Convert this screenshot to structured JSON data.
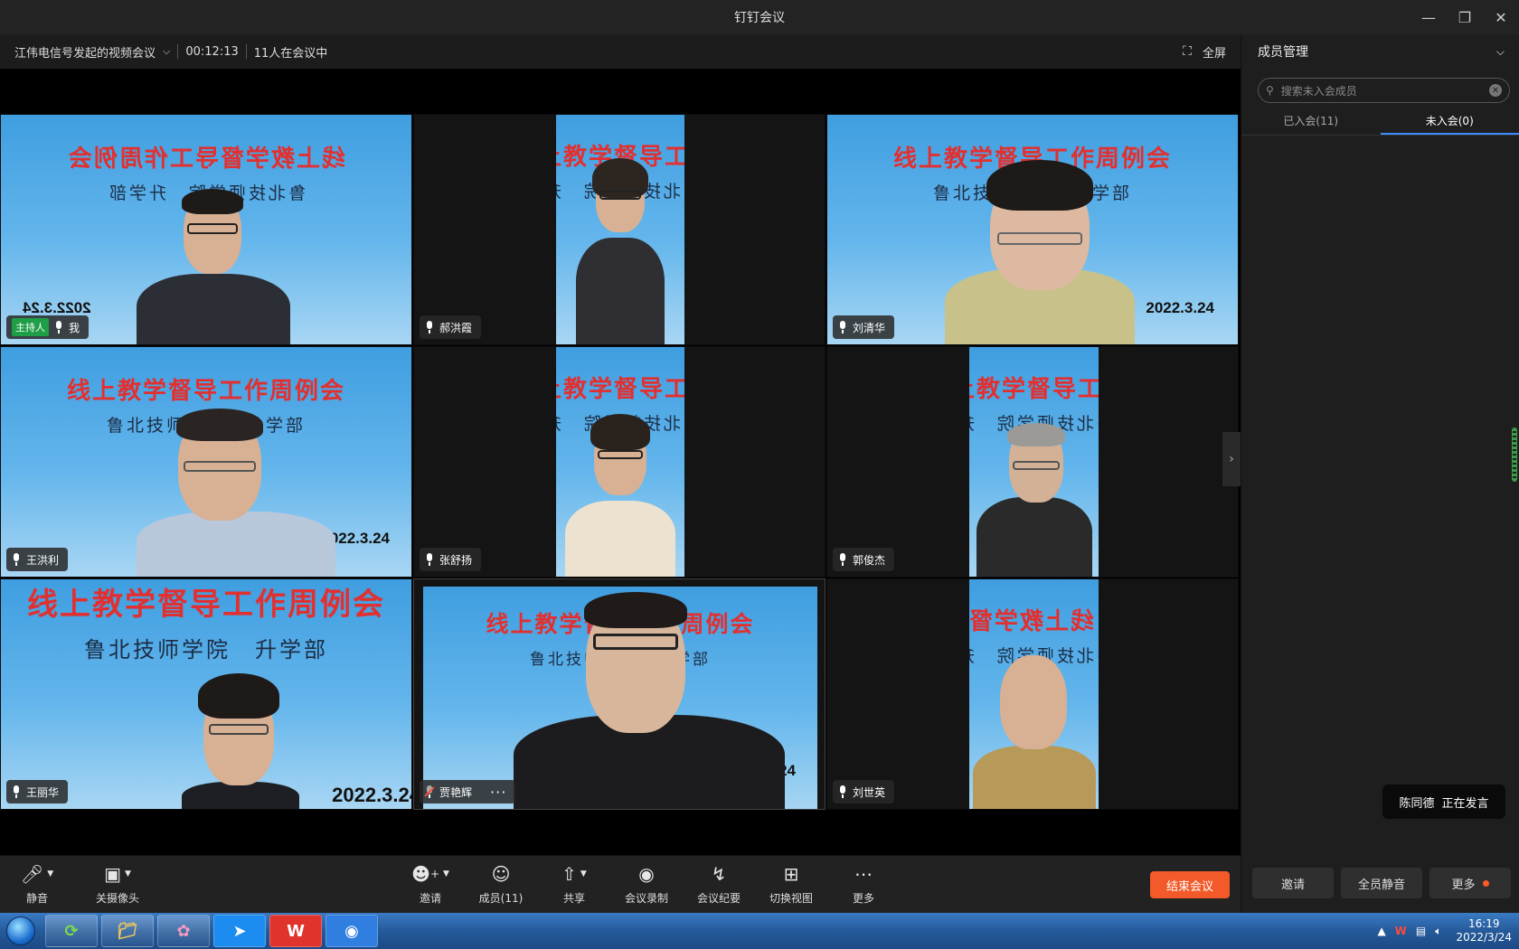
{
  "window": {
    "title": "钉钉会议"
  },
  "meeting": {
    "name": "江伟电信号发起的视频会议",
    "duration": "00:12:13",
    "count_text": "11人在会议中",
    "fullscreen_label": "全屏"
  },
  "slide": {
    "title": "线上教学督导工作周例会",
    "subtitle": "鲁北技师学院　升学部",
    "date": "2022.3.24"
  },
  "tiles": [
    {
      "name": "我",
      "host_badge": "主持人",
      "mirrored": true
    },
    {
      "name": "郝洪霞"
    },
    {
      "name": "刘清华"
    },
    {
      "name": "王洪利"
    },
    {
      "name": "张舒扬"
    },
    {
      "name": "郭俊杰"
    },
    {
      "name": "王丽华"
    },
    {
      "name": "贾艳辉",
      "mic_muted": true,
      "more": "···"
    },
    {
      "name": "刘世英"
    }
  ],
  "toolbar": {
    "mute": "静音",
    "camera": "关摄像头",
    "invite": "邀请",
    "members": "成员(11)",
    "share": "共享",
    "record": "会议录制",
    "minutes": "会议纪要",
    "view": "切换视图",
    "more": "更多",
    "end": "结束会议"
  },
  "panel": {
    "title": "成员管理",
    "search_placeholder": "搜索未入会成员",
    "tab_joined": "已入会(11)",
    "tab_not_joined": "未入会(0)",
    "speaking_name": "陈同德",
    "speaking_status": "正在发言",
    "btn_invite": "邀请",
    "btn_mute_all": "全员静音",
    "btn_more": "更多"
  },
  "taskbar": {
    "time": "16:19",
    "date": "2022/3/24"
  },
  "colors": {
    "accent_orange": "#f25a29",
    "host_green": "#1e9e46",
    "tab_blue": "#3b8cff"
  }
}
